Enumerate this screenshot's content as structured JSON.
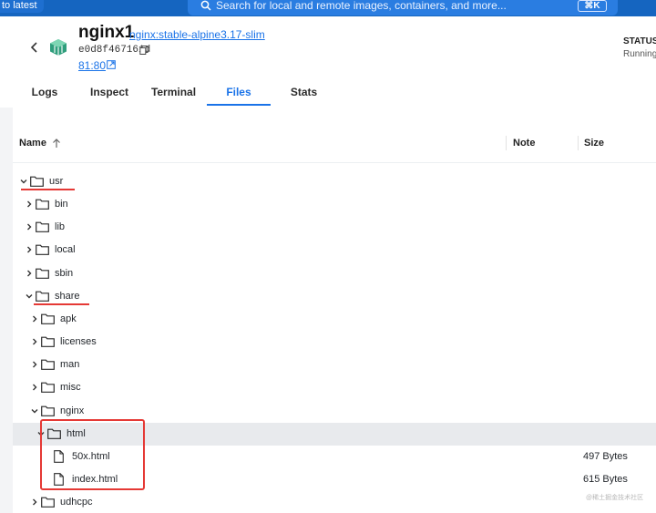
{
  "topbar": {
    "update_text": "to latest",
    "search_placeholder": "Search for local and remote images, containers, and more...",
    "shortcut": "⌘K"
  },
  "header": {
    "container_name": "nginx1",
    "image": "nginx:stable-alpine3.17-slim",
    "container_id": "e0d8f467161d",
    "port": "81:80",
    "status_label": "STATUS",
    "status_value": "Running"
  },
  "tabs": [
    {
      "label": "Logs",
      "active": false
    },
    {
      "label": "Inspect",
      "active": false
    },
    {
      "label": "Terminal",
      "active": false
    },
    {
      "label": "Files",
      "active": true
    },
    {
      "label": "Stats",
      "active": false
    }
  ],
  "table": {
    "columns": [
      "Name",
      "Note",
      "Size"
    ]
  },
  "tree": [
    {
      "name": "usr",
      "type": "folder",
      "expanded": true,
      "depth": 0
    },
    {
      "name": "bin",
      "type": "folder",
      "expanded": false,
      "depth": 1
    },
    {
      "name": "lib",
      "type": "folder",
      "expanded": false,
      "depth": 1
    },
    {
      "name": "local",
      "type": "folder",
      "expanded": false,
      "depth": 1
    },
    {
      "name": "sbin",
      "type": "folder",
      "expanded": false,
      "depth": 1
    },
    {
      "name": "share",
      "type": "folder",
      "expanded": true,
      "depth": 1
    },
    {
      "name": "apk",
      "type": "folder",
      "expanded": false,
      "depth": 2
    },
    {
      "name": "licenses",
      "type": "folder",
      "expanded": false,
      "depth": 2
    },
    {
      "name": "man",
      "type": "folder",
      "expanded": false,
      "depth": 2
    },
    {
      "name": "misc",
      "type": "folder",
      "expanded": false,
      "depth": 2
    },
    {
      "name": "nginx",
      "type": "folder",
      "expanded": true,
      "depth": 2
    },
    {
      "name": "html",
      "type": "folder",
      "expanded": true,
      "depth": 3,
      "selected": true
    },
    {
      "name": "50x.html",
      "type": "file",
      "depth": 4,
      "size": "497 Bytes"
    },
    {
      "name": "index.html",
      "type": "file",
      "depth": 4,
      "size": "615 Bytes"
    },
    {
      "name": "udhcpc",
      "type": "folder",
      "expanded": false,
      "depth": 2
    }
  ],
  "watermark": "@稀土掘金技术社区",
  "colors": {
    "accent": "#1a73e8",
    "topbar": "#1565c0",
    "annotation": "#e53935",
    "selected_row": "#e8eaed"
  }
}
